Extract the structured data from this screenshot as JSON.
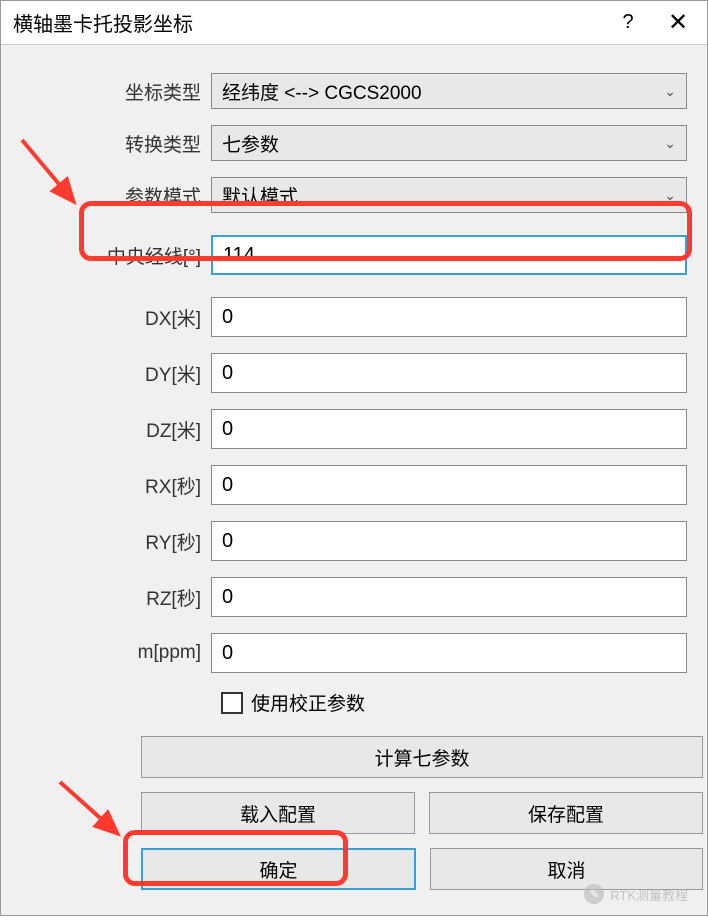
{
  "titlebar": {
    "title": "横轴墨卡托投影坐标",
    "help_icon": "?",
    "close_icon": "✕"
  },
  "form": {
    "coord_type": {
      "label": "坐标类型",
      "value": "经纬度 <--> CGCS2000"
    },
    "transform_type": {
      "label": "转换类型",
      "value": "七参数"
    },
    "param_mode": {
      "label": "参数模式",
      "value": "默认模式"
    },
    "central_meridian": {
      "label": "中央经线[°]",
      "value": "114"
    },
    "dx": {
      "label": "DX[米]",
      "value": "0"
    },
    "dy": {
      "label": "DY[米]",
      "value": "0"
    },
    "dz": {
      "label": "DZ[米]",
      "value": "0"
    },
    "rx": {
      "label": "RX[秒]",
      "value": "0"
    },
    "ry": {
      "label": "RY[秒]",
      "value": "0"
    },
    "rz": {
      "label": "RZ[秒]",
      "value": "0"
    },
    "m": {
      "label": "m[ppm]",
      "value": "0"
    },
    "use_correction": {
      "label": "使用校正参数"
    },
    "calc_seven": "计算七参数",
    "load_config": "载入配置",
    "save_config": "保存配置",
    "ok": "确定",
    "cancel": "取消"
  },
  "watermark": {
    "text": "RTK测量教程",
    "icon": "✎"
  },
  "colors": {
    "highlight": "#ff3a2f",
    "active_border": "#3aa0d8"
  }
}
